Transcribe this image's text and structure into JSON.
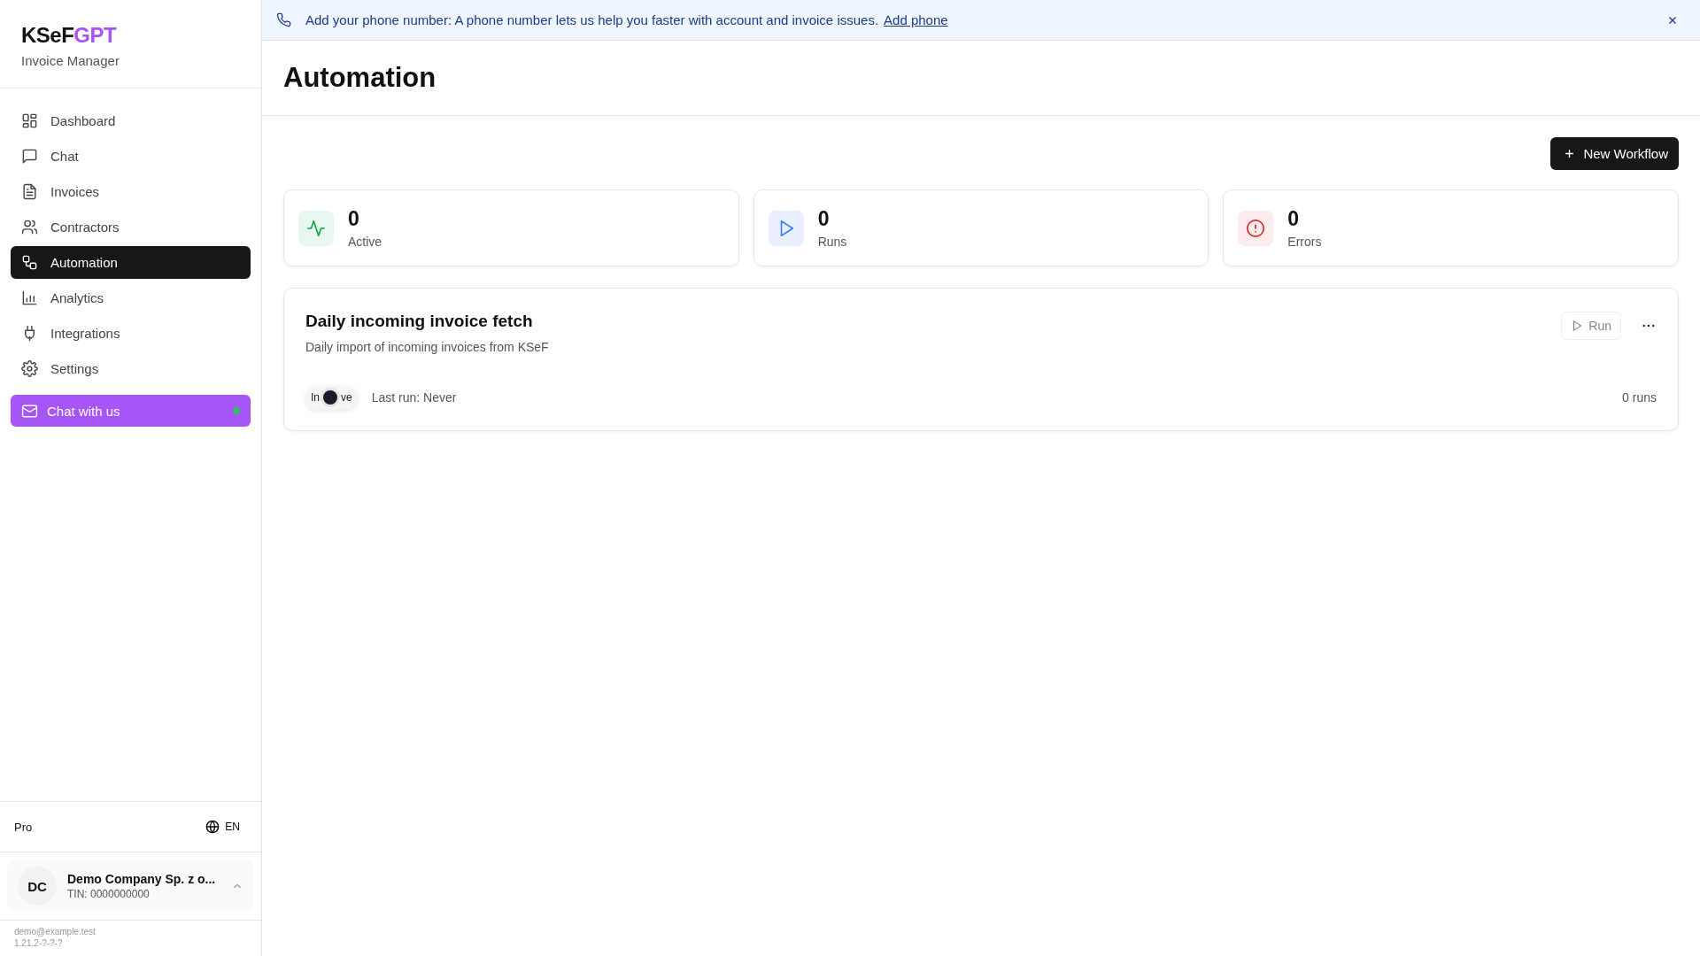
{
  "brand": {
    "name_start": "KSeF",
    "name_end": "GPT",
    "subtitle": "Invoice Manager"
  },
  "nav": [
    {
      "label": "Dashboard",
      "kind": "grid",
      "selected": false
    },
    {
      "label": "Chat",
      "kind": "chat",
      "selected": false
    },
    {
      "label": "Invoices",
      "kind": "file",
      "selected": false
    },
    {
      "label": "Contractors",
      "kind": "users",
      "selected": false
    },
    {
      "label": "Automation",
      "kind": "workflow",
      "selected": true
    },
    {
      "label": "Analytics",
      "kind": "chart",
      "selected": false
    },
    {
      "label": "Integrations",
      "kind": "plug",
      "selected": false
    },
    {
      "label": "Settings",
      "kind": "gear",
      "selected": false
    }
  ],
  "chat_button": {
    "label": "Chat with us",
    "online": true
  },
  "plan": "Pro",
  "language": "EN",
  "company": {
    "initials": "DC",
    "name": "Demo Company Sp. z o...",
    "tin": "TIN: 0000000000"
  },
  "footer": {
    "email": "demo@example.test",
    "version": "1.21.2-?-?-?"
  },
  "banner": {
    "text": "Add your phone number: A phone number lets us help you faster with account and invoice issues.",
    "link": "Add phone"
  },
  "page_title": "Automation",
  "new_button": "New Workflow",
  "stats": [
    {
      "kind": "active",
      "value": "0",
      "label": "Active"
    },
    {
      "kind": "runs",
      "value": "0",
      "label": "Runs"
    },
    {
      "kind": "errors",
      "value": "0",
      "label": "Errors"
    }
  ],
  "workflows": [
    {
      "title": "Daily incoming invoice fetch",
      "description": "Daily import of incoming invoices from KSeF",
      "run_label": "Run",
      "toggle": {
        "on": false,
        "label_start": "In",
        "label_end": "ve"
      },
      "last_run": "Last run: Never",
      "runs": "0 runs"
    }
  ]
}
